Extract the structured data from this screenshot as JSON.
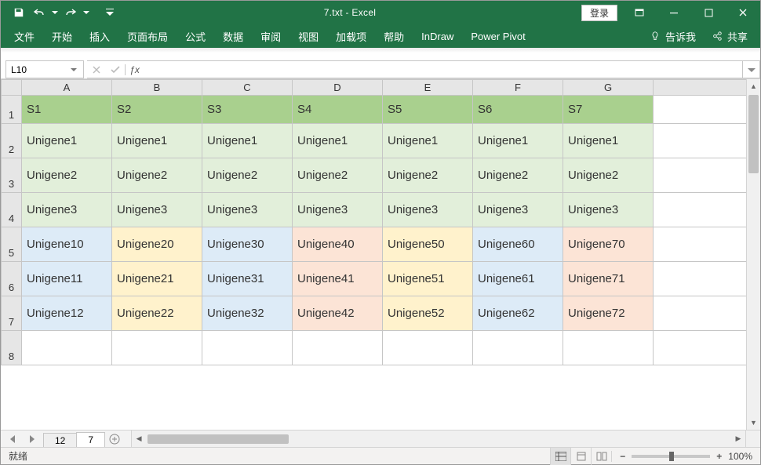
{
  "title": "7.txt  -  Excel",
  "qat": {
    "save": "save",
    "undo": "undo",
    "redo": "redo",
    "more": "more"
  },
  "login_label": "登录",
  "ribbon_tabs": [
    "文件",
    "开始",
    "插入",
    "页面布局",
    "公式",
    "数据",
    "审阅",
    "视图",
    "加载项",
    "帮助",
    "InDraw",
    "Power Pivot"
  ],
  "tell_me": "告诉我",
  "share": "共享",
  "namebox": "L10",
  "formula": "",
  "columns": [
    "A",
    "B",
    "C",
    "D",
    "E",
    "F",
    "G",
    ""
  ],
  "rows": [
    {
      "n": "1",
      "cls": "hrow",
      "cells": [
        {
          "v": "S1",
          "f": "hdr"
        },
        {
          "v": "S2",
          "f": "hdr"
        },
        {
          "v": "S3",
          "f": "hdr"
        },
        {
          "v": "S4",
          "f": "hdr"
        },
        {
          "v": "S5",
          "f": "hdr"
        },
        {
          "v": "S6",
          "f": "hdr"
        },
        {
          "v": "S7",
          "f": "hdr"
        },
        {
          "v": "",
          "f": ""
        }
      ]
    },
    {
      "n": "2",
      "cls": "",
      "cells": [
        {
          "v": "Unigene1",
          "f": "g"
        },
        {
          "v": "Unigene1",
          "f": "g"
        },
        {
          "v": "Unigene1",
          "f": "g"
        },
        {
          "v": "Unigene1",
          "f": "g"
        },
        {
          "v": "Unigene1",
          "f": "g"
        },
        {
          "v": "Unigene1",
          "f": "g"
        },
        {
          "v": "Unigene1",
          "f": "g"
        },
        {
          "v": "",
          "f": ""
        }
      ]
    },
    {
      "n": "3",
      "cls": "",
      "cells": [
        {
          "v": "Unigene2",
          "f": "g"
        },
        {
          "v": "Unigene2",
          "f": "g"
        },
        {
          "v": "Unigene2",
          "f": "g"
        },
        {
          "v": "Unigene2",
          "f": "g"
        },
        {
          "v": "Unigene2",
          "f": "g"
        },
        {
          "v": "Unigene2",
          "f": "g"
        },
        {
          "v": "Unigene2",
          "f": "g"
        },
        {
          "v": "",
          "f": ""
        }
      ]
    },
    {
      "n": "4",
      "cls": "",
      "cells": [
        {
          "v": "Unigene3",
          "f": "g"
        },
        {
          "v": "Unigene3",
          "f": "g"
        },
        {
          "v": "Unigene3",
          "f": "g"
        },
        {
          "v": "Unigene3",
          "f": "g"
        },
        {
          "v": "Unigene3",
          "f": "g"
        },
        {
          "v": "Unigene3",
          "f": "g"
        },
        {
          "v": "Unigene3",
          "f": "g"
        },
        {
          "v": "",
          "f": ""
        }
      ]
    },
    {
      "n": "5",
      "cls": "",
      "cells": [
        {
          "v": "Unigene10",
          "f": "bl"
        },
        {
          "v": "Unigene20",
          "f": "ye"
        },
        {
          "v": "Unigene30",
          "f": "bl"
        },
        {
          "v": "Unigene40",
          "f": "or"
        },
        {
          "v": "Unigene50",
          "f": "ye"
        },
        {
          "v": "Unigene60",
          "f": "bl"
        },
        {
          "v": "Unigene70",
          "f": "or"
        },
        {
          "v": "",
          "f": ""
        }
      ]
    },
    {
      "n": "6",
      "cls": "",
      "cells": [
        {
          "v": "Unigene11",
          "f": "bl"
        },
        {
          "v": "Unigene21",
          "f": "ye"
        },
        {
          "v": "Unigene31",
          "f": "bl"
        },
        {
          "v": "Unigene41",
          "f": "or"
        },
        {
          "v": "Unigene51",
          "f": "ye"
        },
        {
          "v": "Unigene61",
          "f": "bl"
        },
        {
          "v": "Unigene71",
          "f": "or"
        },
        {
          "v": "",
          "f": ""
        }
      ]
    },
    {
      "n": "7",
      "cls": "",
      "cells": [
        {
          "v": "Unigene12",
          "f": "bl"
        },
        {
          "v": "Unigene22",
          "f": "ye"
        },
        {
          "v": "Unigene32",
          "f": "bl"
        },
        {
          "v": "Unigene42",
          "f": "or"
        },
        {
          "v": "Unigene52",
          "f": "ye"
        },
        {
          "v": "Unigene62",
          "f": "bl"
        },
        {
          "v": "Unigene72",
          "f": "or"
        },
        {
          "v": "",
          "f": ""
        }
      ]
    },
    {
      "n": "8",
      "cls": "tailrow",
      "cells": [
        {
          "v": "",
          "f": ""
        },
        {
          "v": "",
          "f": ""
        },
        {
          "v": "",
          "f": ""
        },
        {
          "v": "",
          "f": ""
        },
        {
          "v": "",
          "f": ""
        },
        {
          "v": "",
          "f": ""
        },
        {
          "v": "",
          "f": ""
        },
        {
          "v": "",
          "f": ""
        }
      ]
    }
  ],
  "sheet_tabs": [
    {
      "label": "12",
      "active": false
    },
    {
      "label": "7",
      "active": true
    }
  ],
  "add_sheet": "+",
  "status_ready": "就绪",
  "zoom_pct": "100%"
}
